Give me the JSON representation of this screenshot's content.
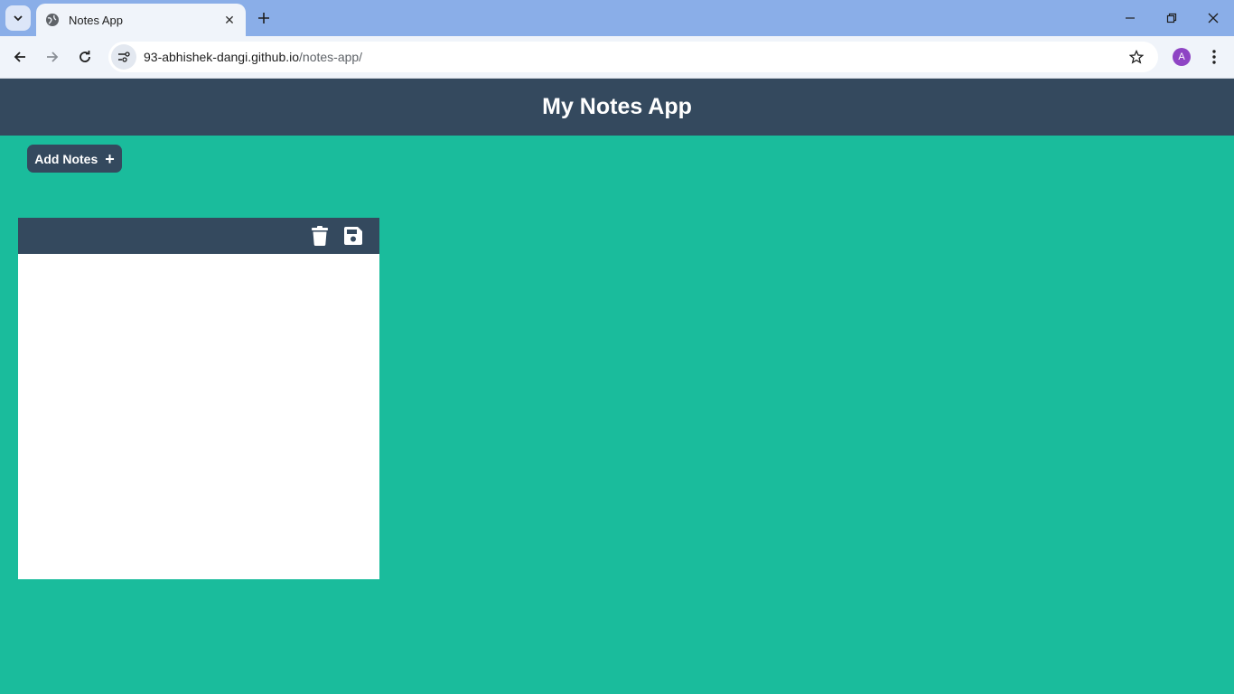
{
  "browser": {
    "tab_title": "Notes App",
    "tab_close": "✕",
    "url_host": "93-abhishek-dangi.github.io",
    "url_path": "/notes-app/",
    "profile_initial": "A"
  },
  "app": {
    "title": "My Notes App",
    "add_button_label": "Add Notes",
    "add_button_icon": "+"
  },
  "note": {
    "content": "",
    "icons": [
      "trash-icon",
      "save-icon"
    ]
  },
  "colors": {
    "page_bg": "#1abc9c",
    "header_bg": "#34495e",
    "note_bg": "#ffffff"
  }
}
